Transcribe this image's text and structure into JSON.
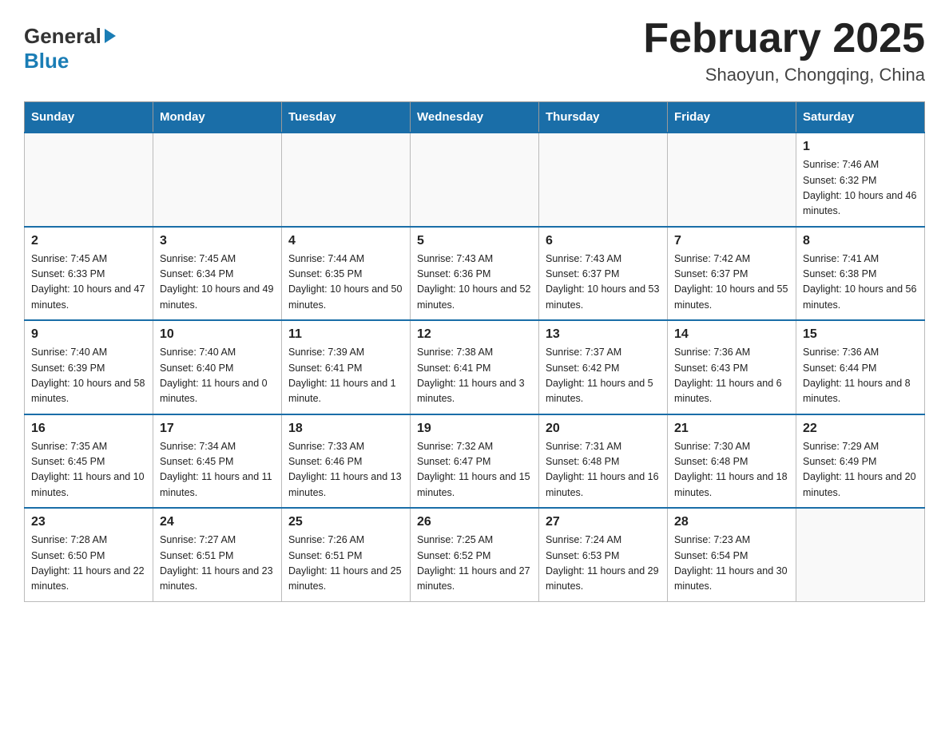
{
  "header": {
    "logo_general": "General",
    "logo_blue": "Blue",
    "month_title": "February 2025",
    "location": "Shaoyun, Chongqing, China"
  },
  "days_of_week": [
    "Sunday",
    "Monday",
    "Tuesday",
    "Wednesday",
    "Thursday",
    "Friday",
    "Saturday"
  ],
  "weeks": [
    [
      {
        "day": "",
        "info": ""
      },
      {
        "day": "",
        "info": ""
      },
      {
        "day": "",
        "info": ""
      },
      {
        "day": "",
        "info": ""
      },
      {
        "day": "",
        "info": ""
      },
      {
        "day": "",
        "info": ""
      },
      {
        "day": "1",
        "info": "Sunrise: 7:46 AM\nSunset: 6:32 PM\nDaylight: 10 hours and 46 minutes."
      }
    ],
    [
      {
        "day": "2",
        "info": "Sunrise: 7:45 AM\nSunset: 6:33 PM\nDaylight: 10 hours and 47 minutes."
      },
      {
        "day": "3",
        "info": "Sunrise: 7:45 AM\nSunset: 6:34 PM\nDaylight: 10 hours and 49 minutes."
      },
      {
        "day": "4",
        "info": "Sunrise: 7:44 AM\nSunset: 6:35 PM\nDaylight: 10 hours and 50 minutes."
      },
      {
        "day": "5",
        "info": "Sunrise: 7:43 AM\nSunset: 6:36 PM\nDaylight: 10 hours and 52 minutes."
      },
      {
        "day": "6",
        "info": "Sunrise: 7:43 AM\nSunset: 6:37 PM\nDaylight: 10 hours and 53 minutes."
      },
      {
        "day": "7",
        "info": "Sunrise: 7:42 AM\nSunset: 6:37 PM\nDaylight: 10 hours and 55 minutes."
      },
      {
        "day": "8",
        "info": "Sunrise: 7:41 AM\nSunset: 6:38 PM\nDaylight: 10 hours and 56 minutes."
      }
    ],
    [
      {
        "day": "9",
        "info": "Sunrise: 7:40 AM\nSunset: 6:39 PM\nDaylight: 10 hours and 58 minutes."
      },
      {
        "day": "10",
        "info": "Sunrise: 7:40 AM\nSunset: 6:40 PM\nDaylight: 11 hours and 0 minutes."
      },
      {
        "day": "11",
        "info": "Sunrise: 7:39 AM\nSunset: 6:41 PM\nDaylight: 11 hours and 1 minute."
      },
      {
        "day": "12",
        "info": "Sunrise: 7:38 AM\nSunset: 6:41 PM\nDaylight: 11 hours and 3 minutes."
      },
      {
        "day": "13",
        "info": "Sunrise: 7:37 AM\nSunset: 6:42 PM\nDaylight: 11 hours and 5 minutes."
      },
      {
        "day": "14",
        "info": "Sunrise: 7:36 AM\nSunset: 6:43 PM\nDaylight: 11 hours and 6 minutes."
      },
      {
        "day": "15",
        "info": "Sunrise: 7:36 AM\nSunset: 6:44 PM\nDaylight: 11 hours and 8 minutes."
      }
    ],
    [
      {
        "day": "16",
        "info": "Sunrise: 7:35 AM\nSunset: 6:45 PM\nDaylight: 11 hours and 10 minutes."
      },
      {
        "day": "17",
        "info": "Sunrise: 7:34 AM\nSunset: 6:45 PM\nDaylight: 11 hours and 11 minutes."
      },
      {
        "day": "18",
        "info": "Sunrise: 7:33 AM\nSunset: 6:46 PM\nDaylight: 11 hours and 13 minutes."
      },
      {
        "day": "19",
        "info": "Sunrise: 7:32 AM\nSunset: 6:47 PM\nDaylight: 11 hours and 15 minutes."
      },
      {
        "day": "20",
        "info": "Sunrise: 7:31 AM\nSunset: 6:48 PM\nDaylight: 11 hours and 16 minutes."
      },
      {
        "day": "21",
        "info": "Sunrise: 7:30 AM\nSunset: 6:48 PM\nDaylight: 11 hours and 18 minutes."
      },
      {
        "day": "22",
        "info": "Sunrise: 7:29 AM\nSunset: 6:49 PM\nDaylight: 11 hours and 20 minutes."
      }
    ],
    [
      {
        "day": "23",
        "info": "Sunrise: 7:28 AM\nSunset: 6:50 PM\nDaylight: 11 hours and 22 minutes."
      },
      {
        "day": "24",
        "info": "Sunrise: 7:27 AM\nSunset: 6:51 PM\nDaylight: 11 hours and 23 minutes."
      },
      {
        "day": "25",
        "info": "Sunrise: 7:26 AM\nSunset: 6:51 PM\nDaylight: 11 hours and 25 minutes."
      },
      {
        "day": "26",
        "info": "Sunrise: 7:25 AM\nSunset: 6:52 PM\nDaylight: 11 hours and 27 minutes."
      },
      {
        "day": "27",
        "info": "Sunrise: 7:24 AM\nSunset: 6:53 PM\nDaylight: 11 hours and 29 minutes."
      },
      {
        "day": "28",
        "info": "Sunrise: 7:23 AM\nSunset: 6:54 PM\nDaylight: 11 hours and 30 minutes."
      },
      {
        "day": "",
        "info": ""
      }
    ]
  ]
}
